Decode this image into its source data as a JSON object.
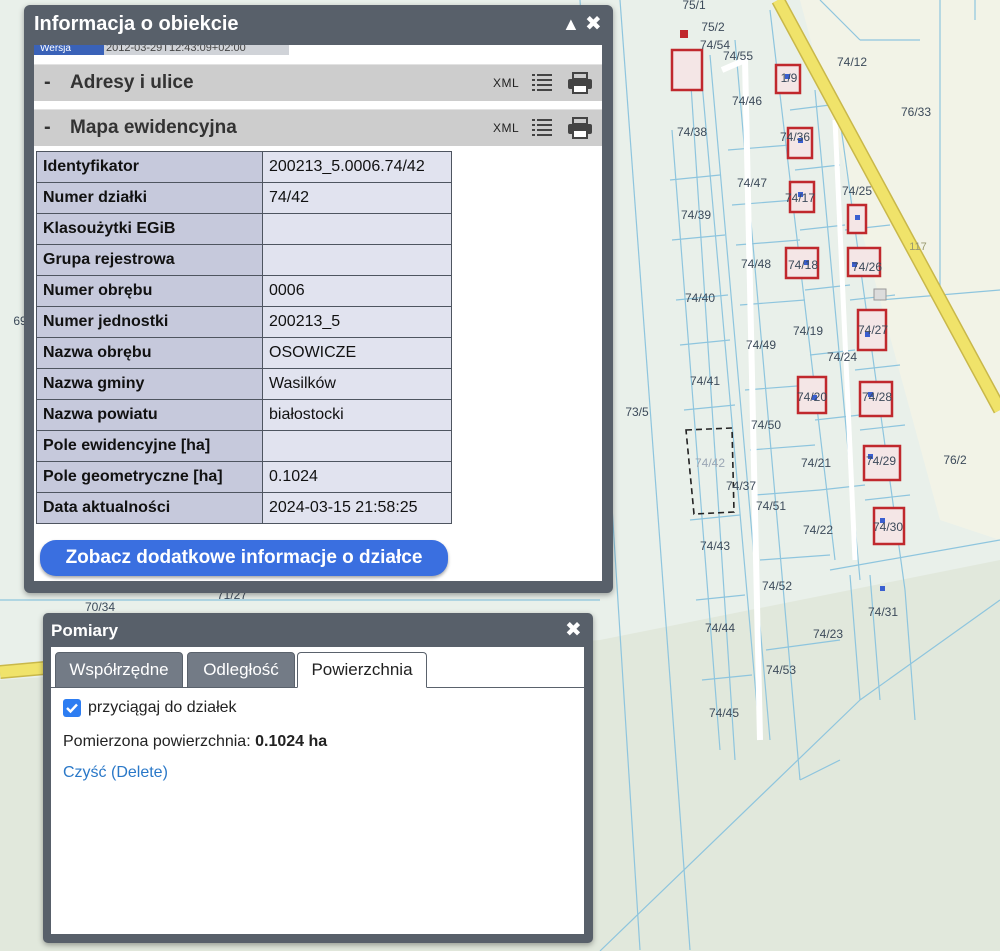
{
  "map": {
    "parcel_labels": [
      "75/1",
      "75/2",
      "74/54",
      "74/55",
      "74/12",
      "74/46",
      "76/33",
      "74/38",
      "74/47",
      "74/25",
      "74/39",
      "74/48",
      "74/40",
      "74/19",
      "74/49",
      "74/24",
      "74/41",
      "73/5",
      "74/50",
      "74/21",
      "76/2",
      "74/42",
      "74/37",
      "74/51",
      "74/22",
      "74/43",
      "74/52",
      "74/31",
      "74/44",
      "74/23",
      "74/53",
      "74/45",
      "70/34",
      "71/27"
    ],
    "building_labels": [
      "1/9",
      "74/36",
      "74/17",
      "74/18",
      "74/26",
      "74/27",
      "74/20",
      "74/28",
      "74/29",
      "74/30"
    ],
    "road_number": "117",
    "edge_label": "69"
  },
  "info_window": {
    "title": "Informacja o obiekcie",
    "collapse_icon": "triangle-up-icon",
    "close_icon": "close-icon",
    "version_tag": "Wersja",
    "version_text": "2012-03-29T12:43:09+02:00",
    "sections": [
      {
        "label": "Adresy i ulice",
        "xml": "XML"
      },
      {
        "label": "Mapa ewidencyjna",
        "xml": "XML"
      }
    ],
    "attributes": [
      {
        "key": "Identyfikator",
        "value": "200213_5.0006.74/42"
      },
      {
        "key": "Numer działki",
        "value": "74/42"
      },
      {
        "key": "Klasoużytki EGiB",
        "value": ""
      },
      {
        "key": "Grupa rejestrowa",
        "value": ""
      },
      {
        "key": "Numer obrębu",
        "value": "0006"
      },
      {
        "key": "Numer jednostki",
        "value": "200213_5"
      },
      {
        "key": "Nazwa obrębu",
        "value": "OSOWICZE"
      },
      {
        "key": "Nazwa gminy",
        "value": "Wasilków"
      },
      {
        "key": "Nazwa powiatu",
        "value": "białostocki"
      },
      {
        "key": "Pole ewidencyjne [ha]",
        "value": ""
      },
      {
        "key": "Pole geometryczne [ha]",
        "value": "0.1024"
      },
      {
        "key": "Data aktualności",
        "value": "2024-03-15 21:58:25"
      }
    ],
    "more_button": "Zobacz dodatkowe informacje o działce"
  },
  "measure_window": {
    "title": "Pomiary",
    "tabs": [
      {
        "label": "Współrzędne",
        "active": false
      },
      {
        "label": "Odległość",
        "active": false
      },
      {
        "label": "Powierzchnia",
        "active": true
      }
    ],
    "snap_label": "przyciągaj do działek",
    "snap_checked": true,
    "measured_label": "Pomierzona powierzchnia:",
    "measured_value": "0.1024 ha",
    "clear_link": "Czyść (Delete)"
  },
  "colors": {
    "road": "#f0e36a",
    "parcel_line": "#8ec5de",
    "building": "#c0282d",
    "accent_button": "#3a6fe0",
    "window_frame": "#58606a"
  }
}
